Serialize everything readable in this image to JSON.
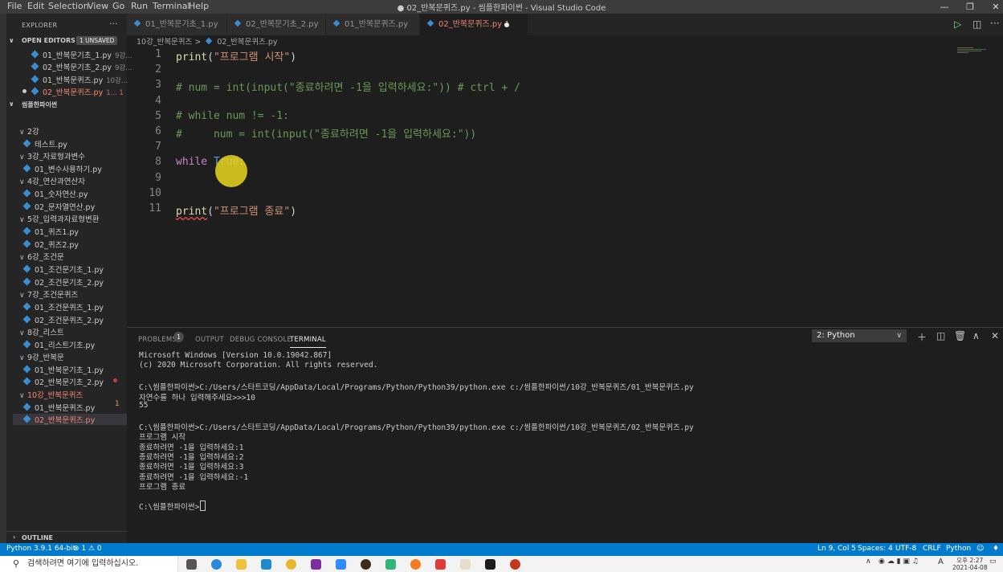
{
  "window": {
    "title": "● 02_반복문퀴즈.py - 씸플한파이썬 - Visual Studio Code",
    "menu": [
      "File",
      "Edit",
      "Selection",
      "View",
      "Go",
      "Run",
      "Terminal",
      "Help"
    ]
  },
  "sidebar": {
    "header": "EXPLORER",
    "open_editors_label": "OPEN EDITORS",
    "unsaved_badge": "1 UNSAVED",
    "open_editors": [
      {
        "name": "01_반복문기초_1.py",
        "desc": "9강..."
      },
      {
        "name": "02_반복문기초_2.py",
        "desc": "9강..."
      },
      {
        "name": "01_반복문퀴즈.py",
        "desc": "10강..."
      },
      {
        "name": "02_반복문퀴즈.py",
        "desc": "1...  1"
      }
    ],
    "workspace_label": "씸플한파이썬",
    "tree": [
      {
        "label": "2강",
        "type": "folder"
      },
      {
        "label": "테스트.py",
        "type": "file"
      },
      {
        "label": "3강_자료형과변수",
        "type": "folder"
      },
      {
        "label": "01_변수사용하기.py",
        "type": "file"
      },
      {
        "label": "4강_연산과연산자",
        "type": "folder"
      },
      {
        "label": "01_숫자연산.py",
        "type": "file"
      },
      {
        "label": "02_문자열연산.py",
        "type": "file"
      },
      {
        "label": "5강_입력과자료형변환",
        "type": "folder"
      },
      {
        "label": "01_퀴즈1.py",
        "type": "file"
      },
      {
        "label": "02_퀴즈2.py",
        "type": "file"
      },
      {
        "label": "6강_조건문",
        "type": "folder"
      },
      {
        "label": "01_조건문기초_1.py",
        "type": "file"
      },
      {
        "label": "02_조건문기초_2.py",
        "type": "file"
      },
      {
        "label": "7강_조건문퀴즈",
        "type": "folder"
      },
      {
        "label": "01_조건문퀴즈_1.py",
        "type": "file"
      },
      {
        "label": "02_조건문퀴즈_2.py",
        "type": "file"
      },
      {
        "label": "8강_리스트",
        "type": "folder"
      },
      {
        "label": "01_리스트기초.py",
        "type": "file"
      },
      {
        "label": "9강_반복문",
        "type": "folder"
      },
      {
        "label": "01_반복문기초_1.py",
        "type": "file"
      },
      {
        "label": "02_반복문기초_2.py",
        "type": "file"
      },
      {
        "label": "10강_반복문퀴즈",
        "type": "folder"
      },
      {
        "label": "01_반복문퀴즈.py",
        "type": "file"
      },
      {
        "label": "02_반복문퀴즈.py",
        "type": "file"
      }
    ],
    "selected_problem_count": "1",
    "outline_label": "OUTLINE"
  },
  "tabs": [
    {
      "label": "01_반복문기초_1.py"
    },
    {
      "label": "02_반복문기초_2.py"
    },
    {
      "label": "01_반복문퀴즈.py"
    },
    {
      "label": "02_반복문퀴즈.py 1"
    }
  ],
  "breadcrumb": {
    "folder": "10강_반복문퀴즈",
    "sep": ">",
    "file": "02_반복문퀴즈.py"
  },
  "editor": {
    "line_numbers": [
      "1",
      "2",
      "3",
      "4",
      "5",
      "6",
      "7",
      "8",
      "9",
      "10",
      "11"
    ],
    "lines": {
      "l1_fn": "print",
      "l1_open": "(",
      "l1_str": "\"프로그램 시작\"",
      "l1_close": ")",
      "l3": "# num = int(input(\"종료하려면 -1을 입력하세요:\")) # ctrl + /",
      "l5": "# while num != -1:",
      "l6": "#     num = int(input(\"종료하려면 -1을 입력하세요:\"))",
      "l8_kw": "while",
      "l8_const": "True",
      "l8_colon": ":",
      "l11_fn": "print",
      "l11_open": "(",
      "l11_str": "\"프로그램 종료\"",
      "l11_close": ")"
    }
  },
  "panel": {
    "tabs": {
      "problems": "PROBLEMS",
      "problems_count": "1",
      "output": "OUTPUT",
      "debug": "DEBUG CONSOLE",
      "terminal": "TERMINAL"
    },
    "terminal_select": "2: Python",
    "terminal_lines": [
      "Microsoft Windows [Version 10.0.19042.867]",
      "(c) 2020 Microsoft Corporation. All rights reserved.",
      "",
      "C:\\씸플한파이썬>C:/Users/스타트코딩/AppData/Local/Programs/Python/Python39/python.exe c:/씸플한파이썬/10강_반복문퀴즈/01_반복문퀴즈.py",
      "자연수를 하나 입력해주세요>>>10",
      "55",
      "",
      "C:\\씸플한파이썬>C:/Users/스타트코딩/AppData/Local/Programs/Python/Python39/python.exe c:/씸플한파이썬/10강_반복문퀴즈/02_반복문퀴즈.py",
      "프로그램 시작",
      "종료하려면 -1을 입력하세요:1",
      "종료하려면 -1을 입력하세요:2",
      "종료하려면 -1을 입력하세요:3",
      "종료하려면 -1을 입력하세요:-1",
      "프로그램 종료",
      "",
      "C:\\씸플한파이썬>"
    ]
  },
  "statusbar": {
    "python": "Python 3.9.1 64-bit",
    "problems": "⊗ 1 ⚠ 0",
    "position": "Ln 9, Col 5",
    "spaces": "Spaces: 4",
    "encoding": "UTF-8",
    "eol": "CRLF",
    "language": "Python"
  },
  "taskbar": {
    "search_placeholder": "검색하려면 여기에 입력하십시오.",
    "time": "오후 2:27",
    "date": "2021-04-08",
    "ime": "A"
  },
  "colors": {
    "accent": "#007acc",
    "error": "#f48771",
    "cursor_highlight": "#ead61e"
  }
}
